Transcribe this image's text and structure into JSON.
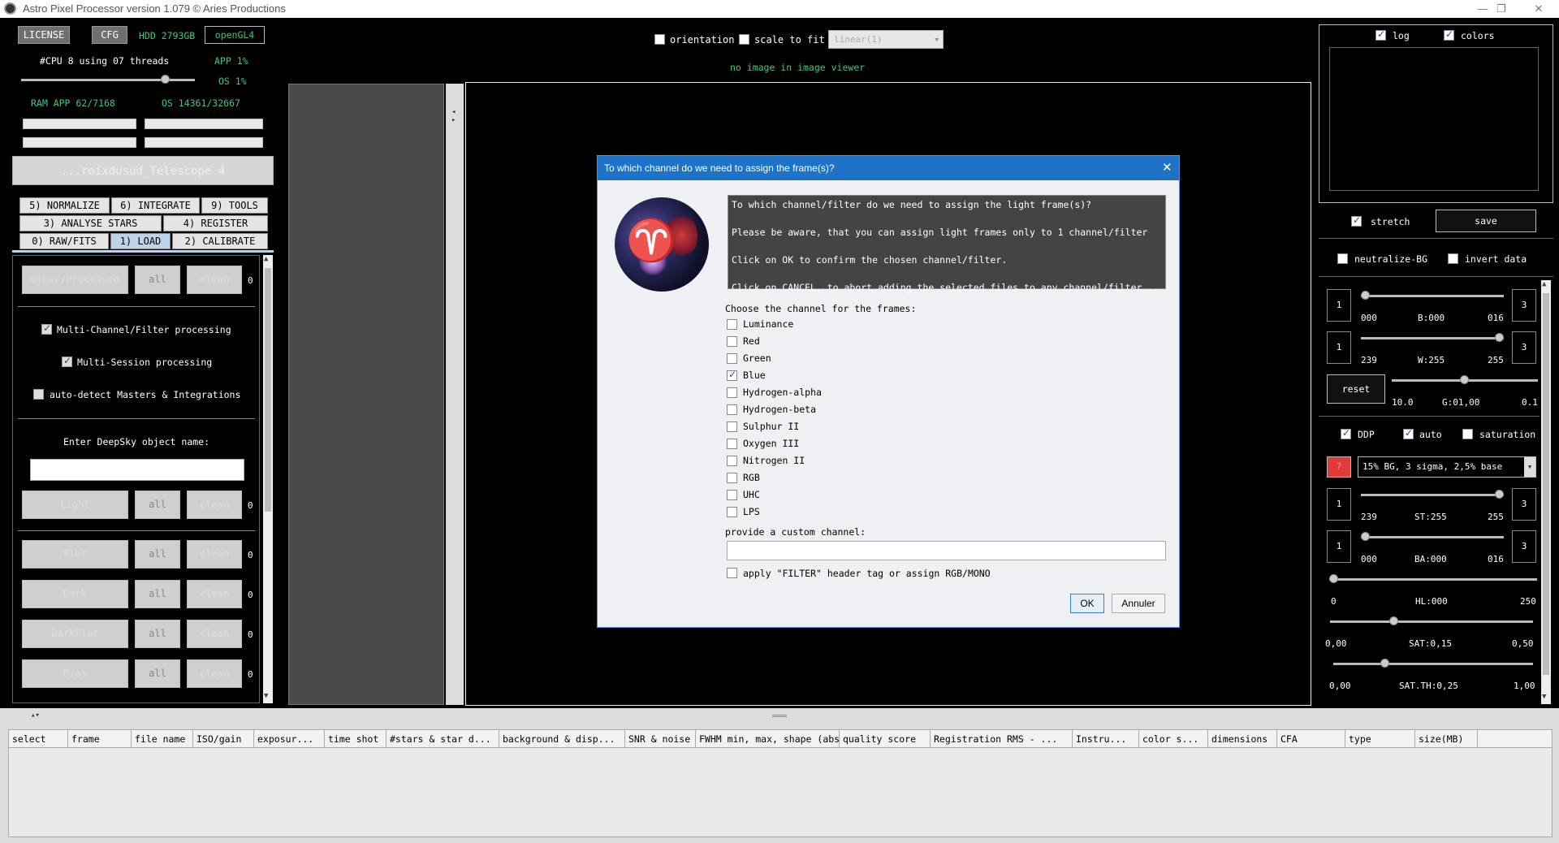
{
  "app": {
    "title": "Astro Pixel Processor version 1.079 © Aries Productions"
  },
  "toolbar": {
    "license": "LICENSE",
    "cfg": "CFG",
    "hdd": "HDD 2793GB",
    "opengl": "openGL4",
    "cpu": "#CPU 8  using 07 threads",
    "app_cpu": "APP 1%",
    "os_cpu": "OS 1%",
    "ram": "RAM  APP 62/7168",
    "os_ram": "OS 14361/32667",
    "project": "...roixdusud_Telescope 4"
  },
  "tabs": {
    "normalize": "5) NORMALIZE",
    "integrate": "6) INTEGRATE",
    "tools": "9) TOOLS",
    "analyse": "3) ANALYSE STARS",
    "register": "4) REGISTER",
    "raw": "0) RAW/FITS",
    "load": "1) LOAD",
    "calibrate": "2) CALIBRATE"
  },
  "load_panel": {
    "other_btn": "Other/Processed",
    "all": "all",
    "clean": "clean",
    "zero": "0",
    "multi_channel": "Multi-Channel/Filter processing",
    "multi_session": "Multi-Session processing",
    "auto_detect": "auto-detect Masters & Integrations",
    "deepsky_label": "Enter DeepSky object name:",
    "light": "Light",
    "flat": "Flat",
    "dark": "Dark",
    "darkflat": "DarkFlat",
    "bias": "Bias"
  },
  "viewer": {
    "orientation": "orientation",
    "scale": "scale to fit",
    "stretch_select": "linear(1)",
    "status": "no image in image viewer"
  },
  "dialog": {
    "title": "To which channel do we need to assign the frame(s)?",
    "msg1": "To which channel/filter do we need to assign the light frame(s)?",
    "msg2": "Please be aware, that you can assign light frames only to 1 channel/filter",
    "msg3": "Click on OK to confirm the chosen channel/filter.",
    "msg4": "Click on CANCEL, to abort adding the selected files to any channel/filter...",
    "choose": "Choose the channel for the frames:",
    "channels": [
      "Luminance",
      "Red",
      "Green",
      "Blue",
      "Hydrogen-alpha",
      "Hydrogen-beta",
      "Sulphur II",
      "Oxygen III",
      "Nitrogen II",
      "RGB",
      "UHC",
      "LPS"
    ],
    "selected": "Blue",
    "custom_label": "provide a custom channel:",
    "apply_filter": "apply \"FILTER\" header tag or assign RGB/MONO",
    "ok": "OK",
    "cancel": "Annuler"
  },
  "right_panel": {
    "log": "log",
    "colors": "colors",
    "stretch": "stretch",
    "save": "save",
    "neutralize": "neutralize-BG",
    "invert": "invert data",
    "b_min": "000",
    "b_label": "B:000",
    "b_max": "016",
    "w_min": "239",
    "w_label": "W:255",
    "w_max": "255",
    "reset": "reset",
    "g_min": "10.0",
    "g_label": "G:01,00",
    "g_max": "0.1",
    "ddp": "DDP",
    "auto": "auto",
    "saturation": "saturation",
    "q": "?",
    "preset": "15% BG, 3 sigma, 2,5% base",
    "st_min": "239",
    "st_label": "ST:255",
    "st_max": "255",
    "ba_min": "000",
    "ba_label": "BA:000",
    "ba_max": "016",
    "hl_min": "0",
    "hl_label": "HL:000",
    "hl_max": "250",
    "sat_min": "0,00",
    "sat_label": "SAT:0,15",
    "sat_max": "0,50",
    "satth_min": "0,00",
    "satth_label": "SAT.TH:0,25",
    "satth_max": "1,00",
    "one": "1",
    "three": "3"
  },
  "table": {
    "columns": [
      "select",
      "frame",
      "file name",
      "ISO/gain",
      "exposur...",
      "time shot",
      "#stars & star d...",
      "background & disp...",
      "SNR & noise",
      "FWHM min, max, shape (abs...",
      "quality score",
      "Registration RMS - ...",
      "Instru...",
      "color s...",
      "dimensions",
      "CFA",
      "type",
      "size(MB)"
    ]
  }
}
